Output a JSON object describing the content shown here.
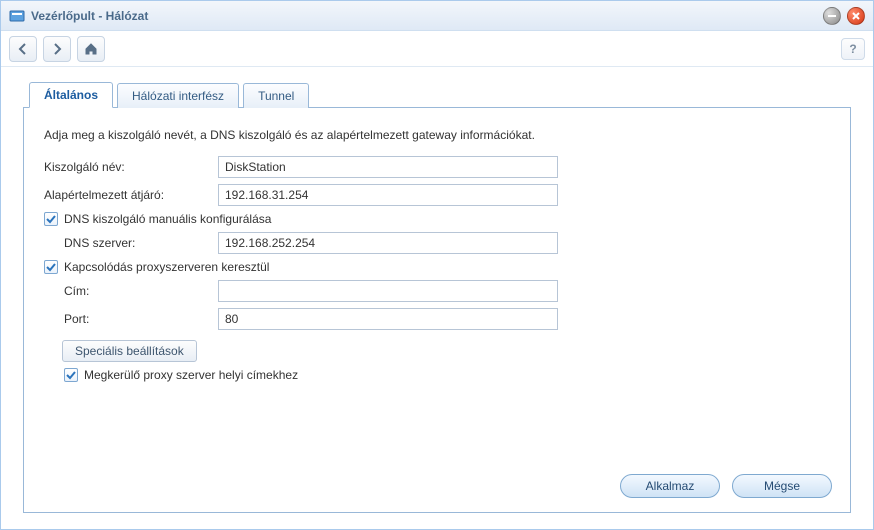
{
  "window": {
    "title": "Vezérlőpult - Hálózat"
  },
  "tabs": {
    "t0": "Általános",
    "t1": "Hálózati interfész",
    "t2": "Tunnel"
  },
  "general": {
    "description": "Adja meg a kiszolgáló nevét, a DNS kiszolgáló és az alapértelmezett gateway információkat.",
    "server_name_label": "Kiszolgáló név:",
    "server_name_value": "DiskStation",
    "gateway_label": "Alapértelmezett átjáró:",
    "gateway_value": "192.168.31.254",
    "manual_dns_label": "DNS kiszolgáló manuális konfigurálása",
    "dns_server_label": "DNS szerver:",
    "dns_server_value": "192.168.252.254",
    "proxy_label": "Kapcsolódás proxyszerveren keresztül",
    "proxy_addr_label": "Cím:",
    "proxy_addr_value": "",
    "proxy_port_label": "Port:",
    "proxy_port_value": "80",
    "advanced_label": "Speciális beállítások",
    "bypass_label": "Megkerülő proxy szerver helyi címekhez"
  },
  "buttons": {
    "apply": "Alkalmaz",
    "cancel": "Mégse",
    "help": "?"
  }
}
